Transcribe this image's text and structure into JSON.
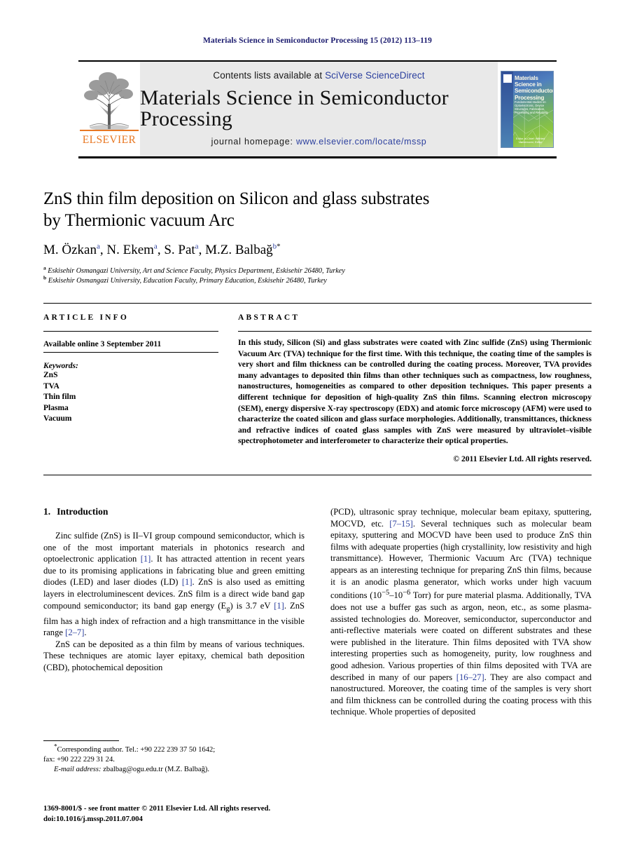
{
  "running_head": "Materials Science in Semiconductor Processing 15 (2012) 113–119",
  "masthead": {
    "contents_prefix": "Contents lists available at ",
    "contents_link": "SciVerse ScienceDirect",
    "journal_title": "Materials Science in Semiconductor Processing",
    "homepage_prefix": "journal homepage: ",
    "homepage_link": "www.elsevier.com/locate/mssp",
    "publisher": "ELSEVIER",
    "cover": {
      "title": "Materials Science in Semiconductor Processing",
      "subtitle": "Fundamental studies on Optoelectronic, Device Structures, Fabrication, Processing and Reliability",
      "footer": "Editor-in-Chief: Wilfried Vandervorst, Editor"
    }
  },
  "paper": {
    "title_line1": "ZnS thin film deposition on Silicon and glass substrates",
    "title_line2": "by Thermionic vacuum Arc",
    "authors": [
      {
        "name": "M. Özkan",
        "sup": "a",
        "sep": ", "
      },
      {
        "name": "N. Ekem",
        "sup": "a",
        "sep": ", "
      },
      {
        "name": "S. Pat",
        "sup": "a",
        "sep": ", "
      },
      {
        "name": "M.Z. Balbağ",
        "sup": "b",
        "star": "*",
        "sep": ""
      }
    ],
    "affiliations": [
      {
        "marker": "a",
        "text": "Eskisehir Osmangazi University, Art and Science Faculty, Physics Department, Eskisehir 26480, Turkey"
      },
      {
        "marker": "b",
        "text": "Eskisehir Osmangazi University, Education Faculty, Primary Education, Eskisehir 26480, Turkey"
      }
    ]
  },
  "article_info": {
    "heading": "ARTICLE INFO",
    "available_online": "Available online 3 September 2011",
    "keywords_label": "Keywords:",
    "keywords": [
      "ZnS",
      "TVA",
      "Thin film",
      "Plasma",
      "Vacuum"
    ]
  },
  "abstract": {
    "heading": "ABSTRACT",
    "text": "In this study, Silicon (Si) and glass substrates were coated with Zinc sulfide (ZnS) using Thermionic Vacuum Arc (TVA) technique for the first time. With this technique, the coating time of the samples is very short and film thickness can be controlled during the coating process. Moreover, TVA provides many advantages to deposited thin films than other techniques such as compactness, low roughness, nanostructures, homogeneities as compared to other deposition techniques. This paper presents a different technique for deposition of high-quality ZnS thin films. Scanning electron microscopy (SEM), energy dispersive X-ray spectroscopy (EDX) and atomic force microscopy (AFM) were used to characterize the coated silicon and glass surface morphologies. Additionally, transmittances, thickness and refractive indices of coated glass samples with ZnS were measured by ultraviolet–visible spectrophotometer and interferometer to characterize their optical properties.",
    "copyright": "© 2011 Elsevier Ltd. All rights reserved."
  },
  "introduction": {
    "number": "1.",
    "heading": "Introduction",
    "left": {
      "para1_a": "Zinc sulfide (ZnS) is II–VI group compound semiconductor, which is one of the most important materials in photonics research and optoelectronic application ",
      "para1_cite1": "[1]",
      "para1_b": ". It has attracted attention in recent years due to its promising applications in fabricating blue and green emitting diodes (LED) and laser diodes (LD) ",
      "para1_cite2": "[1]",
      "para1_c": ". ZnS is also used as emitting layers in electroluminescent devices. ZnS film is a direct wide band gap compound semiconductor; its band gap energy (E",
      "para1_sub": "g",
      "para1_d": ") is 3.7 eV ",
      "para1_cite3": "[1]",
      "para1_e": ". ZnS film has a high index of refraction and a high transmittance in the visible range ",
      "para1_cite4": "[2–7]",
      "para1_f": ".",
      "para2": "ZnS can be deposited as a thin film by means of various techniques. These techniques are atomic layer epitaxy, chemical bath deposition (CBD), photochemical deposition"
    },
    "right": {
      "para_a": "(PCD), ultrasonic spray technique, molecular beam epitaxy, sputtering, MOCVD, etc. ",
      "cite1": "[7–15]",
      "para_b": ". Several techniques such as molecular beam epitaxy, sputtering and MOCVD have been used to produce ZnS thin films with adequate properties (high crystallinity, low resistivity and high transmittance). However, Thermionic Vacuum Arc (TVA) technique appears as an interesting technique for preparing ZnS thin films, because it is an anodic plasma generator, which works under high vacuum conditions (10",
      "sup1": "−5",
      "para_c": "–10",
      "sup2": "−6",
      "para_d": " Torr) for pure material plasma. Additionally, TVA does not use a buffer gas such as argon, neon, etc., as some plasma-assisted technologies do. Moreover, semiconductor, superconductor and anti-reflective materials were coated on different substrates and these were published in the literature. Thin films deposited with TVA show interesting properties such as homogeneity, purity, low roughness and good adhesion. Various properties of thin films deposited with TVA are described in many of our papers ",
      "cite2": "[16–27]",
      "para_e": ". They are also compact and nanostructured. Moreover, the coating time of the samples is very short and film thickness can be controlled during the coating process with this technique. Whole properties of deposited"
    }
  },
  "footnotes": {
    "corresponding": "Corresponding author. Tel.: +90 222 239 37 50 1642;",
    "fax": "fax: +90 222 229 31 24.",
    "email_label": "E-mail address:",
    "email": " zbalbag@ogu.edu.tr (M.Z. Balbağ).",
    "issn_line1": "1369-8001/$ - see front matter © 2011 Elsevier Ltd. All rights reserved.",
    "issn_line2": "doi:10.1016/j.mssp.2011.07.004"
  },
  "colors": {
    "link_blue": "#2b3f9e",
    "running_head_navy": "#1a1a6e",
    "elsevier_orange": "#E87722"
  }
}
